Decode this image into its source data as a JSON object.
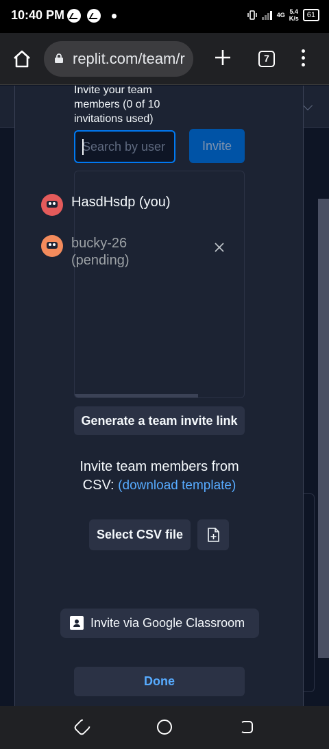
{
  "status_bar": {
    "time": "10:40 PM",
    "net_speed_value": "5.4",
    "net_speed_unit": "K/s",
    "network_type": "4G",
    "battery": "61"
  },
  "browser": {
    "url": "replit.com/team/r",
    "tab_count": "7"
  },
  "modal": {
    "invite_label": "Invite your team members (0 of 10 invitations used)",
    "search_placeholder": "Search by user",
    "invite_button": "Invite",
    "members": [
      {
        "name": "HasdHsdp (you)",
        "avatar_color": "#e45b5b"
      },
      {
        "name": "bucky-26 (pending)",
        "avatar_color": "#f38b5c"
      }
    ],
    "generate_link_button": "Generate a team invite link",
    "csv_text": "Invite team members from CSV:",
    "csv_link": "(download template)",
    "select_csv_button": "Select CSV file",
    "classroom_button": "Invite via Google Classroom",
    "done_button": "Done"
  },
  "colors": {
    "background": "#0e1525",
    "modal": "#1c2333",
    "accent": "#0079f2",
    "link": "#57abff"
  }
}
